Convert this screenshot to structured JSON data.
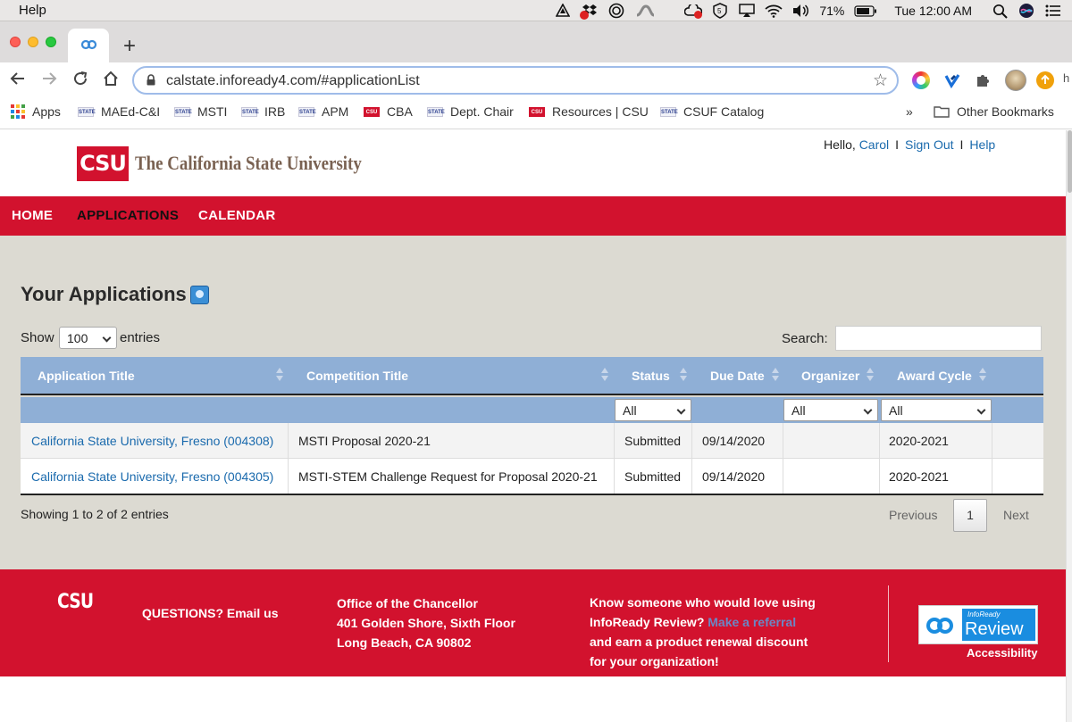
{
  "os_menubar": {
    "menu_help": "Help",
    "battery": "71%",
    "clock": "Tue 12:00 AM",
    "tray_icons": [
      "adobe-icon",
      "dropbox-icon",
      "screen-record-icon",
      "sidecar-icon",
      "creative-cloud-icon",
      "five-icon",
      "airplay-icon",
      "wifi-icon",
      "volume-icon"
    ]
  },
  "browser": {
    "url": "calstate.infoready4.com/#applicationList",
    "bookmarks": [
      {
        "label": "Apps",
        "icon": "apps-grid-icon"
      },
      {
        "label": "MAEd-C&I",
        "icon": "state-icon"
      },
      {
        "label": "MSTI",
        "icon": "state-icon"
      },
      {
        "label": "IRB",
        "icon": "state-icon"
      },
      {
        "label": "APM",
        "icon": "state-icon"
      },
      {
        "label": "CBA",
        "icon": "csu-icon"
      },
      {
        "label": "Dept. Chair",
        "icon": "state-icon"
      },
      {
        "label": "Resources | CSU",
        "icon": "csu-icon"
      },
      {
        "label": "CSUF Catalog",
        "icon": "state-icon"
      }
    ],
    "bookmark_icon_text": {
      "state": "STATE",
      "csu": "CSU"
    },
    "overflow": "»",
    "other_bookmarks": "Other Bookmarks"
  },
  "header": {
    "logo_mark": "CSU",
    "university_name": "The California State University",
    "greeting": "Hello,",
    "user_name": "Carol",
    "sign_out": "Sign Out",
    "help": "Help",
    "separator": "I"
  },
  "nav": {
    "items": [
      "HOME",
      "APPLICATIONS",
      "CALENDAR"
    ],
    "active": "APPLICATIONS"
  },
  "main": {
    "title": "Your Applications",
    "show_label": "Show",
    "entries_value": "100",
    "entries_label": "entries",
    "search_label": "Search:",
    "search_value": "",
    "columns": [
      "Application Title",
      "Competition Title",
      "Status",
      "Due Date",
      "Organizer",
      "Award Cycle"
    ],
    "filters": {
      "status": "All",
      "organizer": "All",
      "award_cycle": "All"
    },
    "rows": [
      {
        "application_title": "California State University, Fresno (004308)",
        "competition_title": "MSTI Proposal 2020-21",
        "status": "Submitted",
        "due_date": "09/14/2020",
        "organizer": "",
        "award_cycle": "2020-2021"
      },
      {
        "application_title": "California State University, Fresno (004305)",
        "competition_title": "MSTI-STEM Challenge Request for Proposal 2020-21",
        "status": "Submitted",
        "due_date": "09/14/2020",
        "organizer": "",
        "award_cycle": "2020-2021"
      }
    ],
    "info": "Showing 1 to 2 of 2 entries",
    "pagination": {
      "previous": "Previous",
      "current": "1",
      "next": "Next"
    }
  },
  "footer": {
    "logo_mark": "CSU",
    "questions": "QUESTIONS? Email us",
    "address": [
      "Office of the Chancellor",
      "401 Golden Shore, Sixth Floor",
      "Long Beach, CA 90802"
    ],
    "referral_line1": "Know someone who would love using",
    "referral_line2_prefix": "InfoReady Review?",
    "referral_link": "Make a referral",
    "referral_line3": "and earn a product renewal discount",
    "referral_line4": "for your organization!",
    "badge_small": "InfoReady",
    "badge_big": "Review",
    "accessibility": "Accessibility"
  },
  "colors": {
    "csu_red": "#d2122e",
    "table_header": "#8fafd6",
    "content_bg": "#dcdad2",
    "link": "#1a6aad"
  }
}
